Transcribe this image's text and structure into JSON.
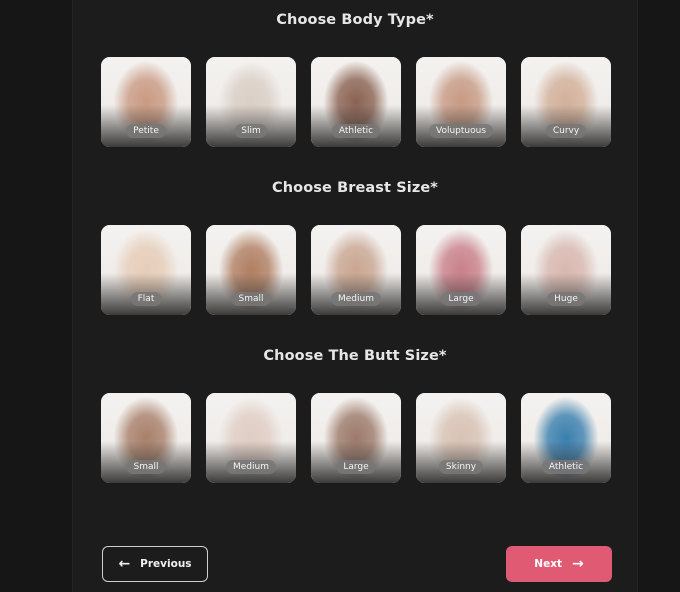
{
  "body_type": {
    "title": "Choose Body Type*",
    "options": [
      {
        "label": "Petite",
        "tone": "#c99a82"
      },
      {
        "label": "Slim",
        "tone": "#d9cfc6"
      },
      {
        "label": "Athletic",
        "tone": "#8a6252"
      },
      {
        "label": "Voluptuous",
        "tone": "#c79a84"
      },
      {
        "label": "Curvy",
        "tone": "#d2b09a"
      }
    ]
  },
  "breast_size": {
    "title": "Choose Breast Size*",
    "options": [
      {
        "label": "Flat",
        "tone": "#e6cdb8"
      },
      {
        "label": "Small",
        "tone": "#b07f62"
      },
      {
        "label": "Medium",
        "tone": "#c9a692"
      },
      {
        "label": "Large",
        "tone": "#c9808a"
      },
      {
        "label": "Huge",
        "tone": "#d8b8b0"
      }
    ]
  },
  "butt_size": {
    "title": "Choose The Butt Size*",
    "options": [
      {
        "label": "Small",
        "tone": "#a8806a"
      },
      {
        "label": "Medium",
        "tone": "#e0cdc4"
      },
      {
        "label": "Large",
        "tone": "#9c7a6a"
      },
      {
        "label": "Skinny",
        "tone": "#d8c2b4"
      },
      {
        "label": "Athletic",
        "tone": "#3a7fae"
      }
    ]
  },
  "nav": {
    "previous_label": "Previous",
    "next_label": "Next"
  },
  "colors": {
    "accent": "#e05a74",
    "background": "#1c1c1c"
  }
}
